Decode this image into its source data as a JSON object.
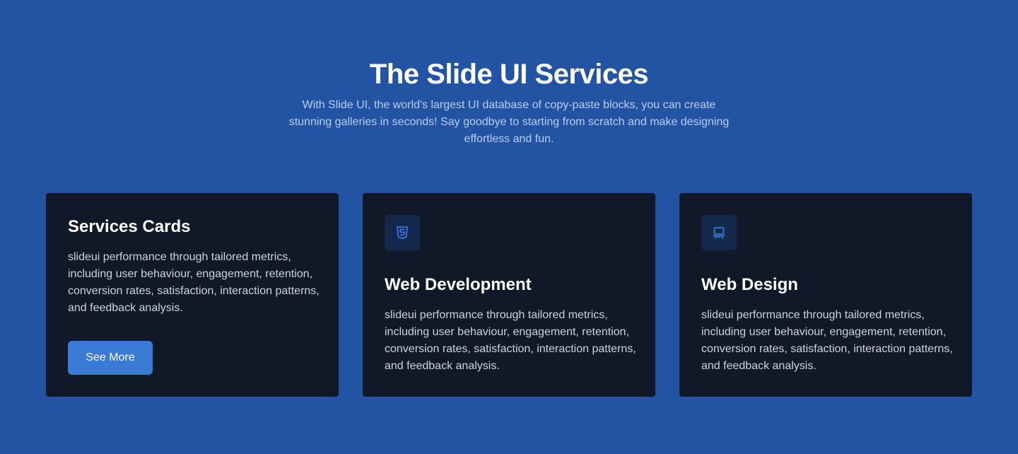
{
  "header": {
    "title": "The Slide UI Services",
    "subtitle": "With Slide UI, the world's largest UI database of copy-paste blocks, you can create stunning galleries in seconds! Say goodbye to starting from scratch and make designing effortless and fun."
  },
  "cards": [
    {
      "title": "Services Cards",
      "text": "slideui performance through tailored metrics, including user behaviour, engagement, retention, conversion rates, satisfaction, interaction patterns, and feedback analysis.",
      "button_label": "See More"
    },
    {
      "icon": "html5-icon",
      "title": "Web Development",
      "text": "slideui performance through tailored metrics, including user behaviour, engagement, retention, conversion rates, satisfaction, interaction patterns, and feedback analysis."
    },
    {
      "icon": "presentation-board-icon",
      "title": "Web Design",
      "text": "slideui performance through tailored metrics, including user behaviour, engagement, retention, conversion rates, satisfaction, interaction patterns, and feedback analysis."
    }
  ],
  "colors": {
    "background": "#2354a3",
    "card": "#111827",
    "accent": "#3a7bd5",
    "icon": "#3b82f6"
  }
}
